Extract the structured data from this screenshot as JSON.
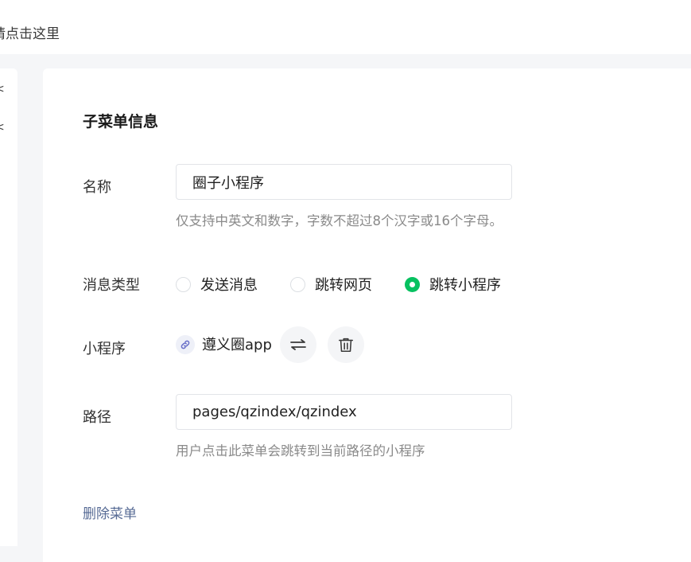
{
  "topbar": {
    "hint": "请点击这里"
  },
  "left_panel": {
    "marks": [
      "<",
      "<"
    ]
  },
  "section": {
    "title": "子菜单信息"
  },
  "name_field": {
    "label": "名称",
    "value": "圈子小程序",
    "help": "仅支持中英文和数字，字数不超过8个汉字或16个字母。"
  },
  "message_type": {
    "label": "消息类型",
    "options": [
      {
        "label": "发送消息",
        "checked": false
      },
      {
        "label": "跳转网页",
        "checked": false
      },
      {
        "label": "跳转小程序",
        "checked": true
      }
    ]
  },
  "mini_program": {
    "label": "小程序",
    "name": "遵义圈app",
    "icon": "link-icon",
    "switch_icon": "swap-icon",
    "delete_icon": "trash-icon"
  },
  "path_field": {
    "label": "路径",
    "value": "pages/qzindex/qzindex",
    "help": "用户点击此菜单会跳转到当前路径的小程序"
  },
  "actions": {
    "delete_menu": "删除菜单"
  },
  "colors": {
    "accent": "#07c160",
    "link": "#576b95"
  }
}
